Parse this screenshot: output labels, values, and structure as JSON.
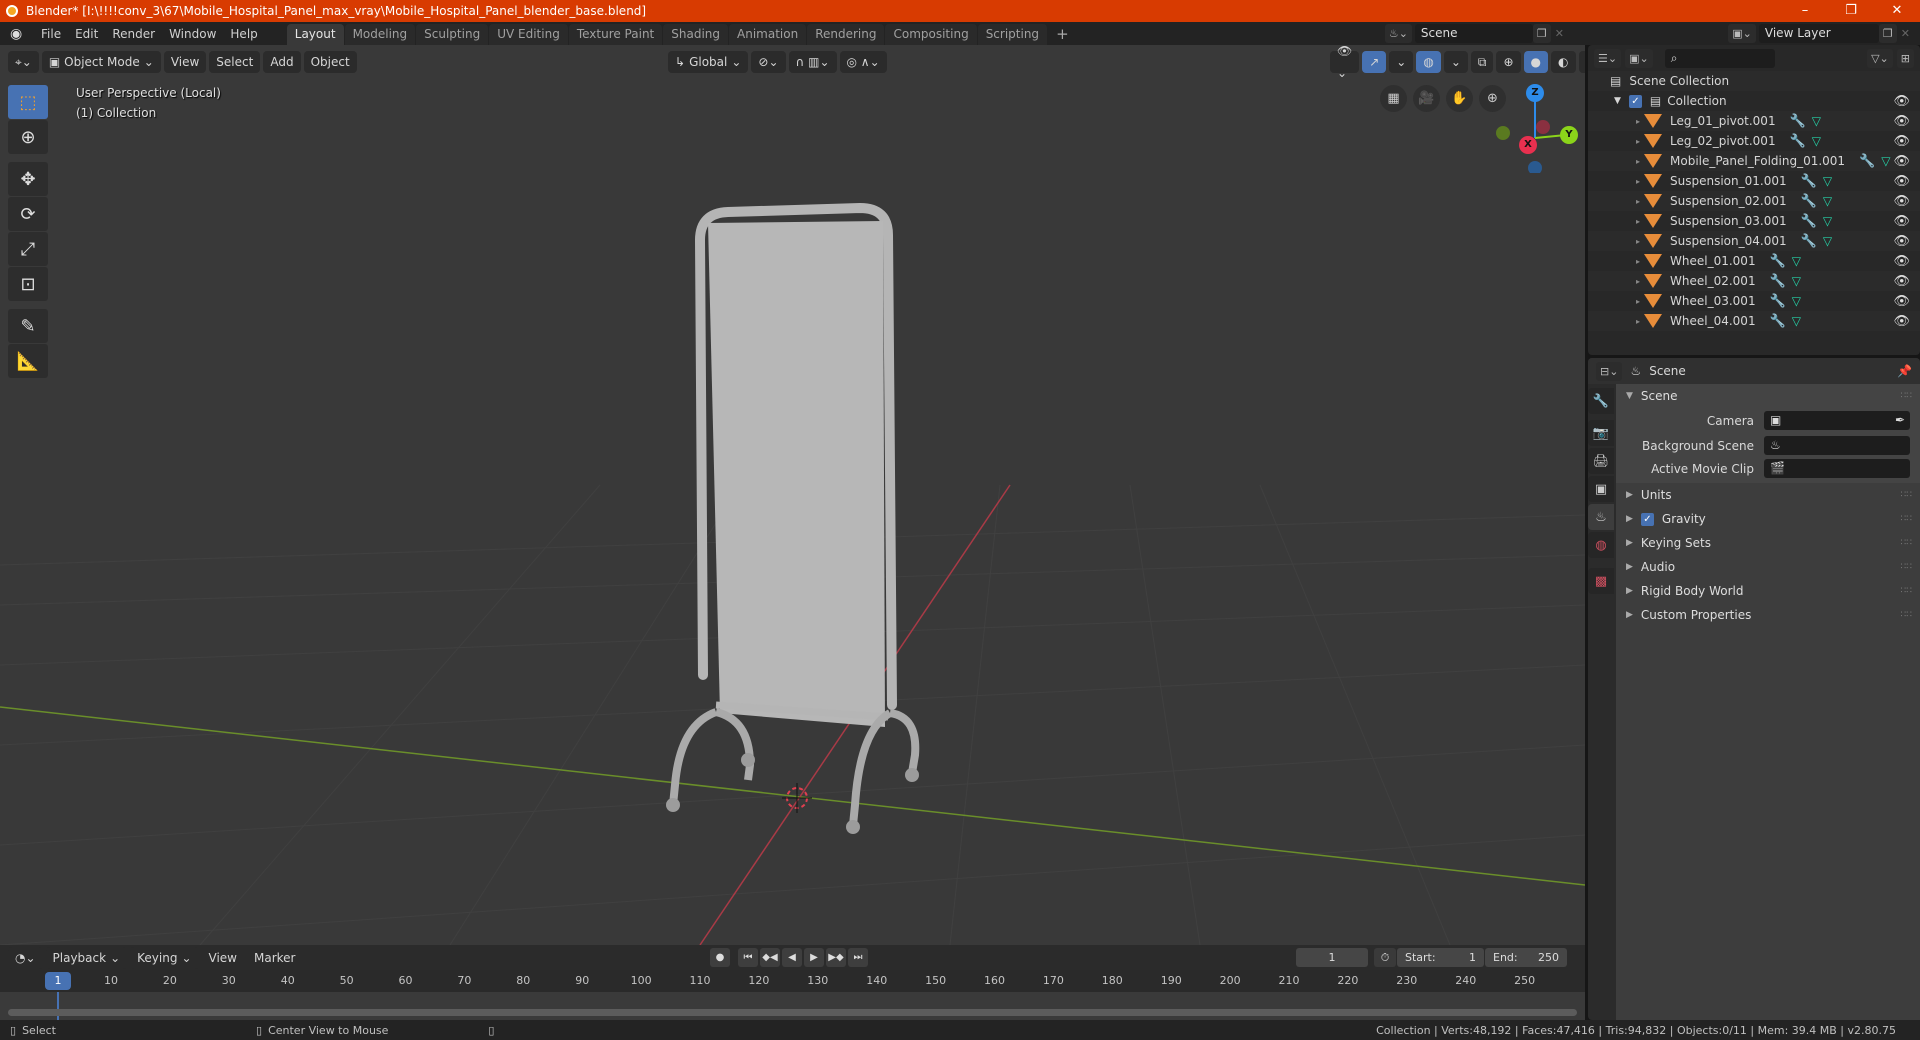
{
  "window": {
    "title": "Blender* [I:\\!!!!conv_3\\67\\Mobile_Hospital_Panel_max_vray\\Mobile_Hospital_Panel_blender_base.blend]",
    "controls": {
      "minimize": "–",
      "maximize": "❐",
      "close": "✕"
    }
  },
  "menubar": {
    "items": [
      "File",
      "Edit",
      "Render",
      "Window",
      "Help"
    ],
    "workspaces": [
      "Layout",
      "Modeling",
      "Sculpting",
      "UV Editing",
      "Texture Paint",
      "Shading",
      "Animation",
      "Rendering",
      "Compositing",
      "Scripting"
    ],
    "active_workspace": "Layout",
    "add_workspace": "+",
    "scene": "Scene",
    "view_layer": "View Layer"
  },
  "viewport": {
    "mode": "Object Mode",
    "menus": [
      "View",
      "Select",
      "Add",
      "Object"
    ],
    "transform_orientation": "Global",
    "info_line1": "User Perspective (Local)",
    "info_line2": "(1) Collection",
    "gizmo_axes": {
      "x": "X",
      "y": "Y",
      "z": "Z"
    },
    "colors": {
      "background": "#393939",
      "x_axis": "#e8304f",
      "y_axis": "#8bd41a",
      "z_axis": "#2d8ceb",
      "model": "#b8b8b8"
    }
  },
  "outliner": {
    "root": "Scene Collection",
    "collection": "Collection",
    "objects": [
      "Leg_01_pivot.001",
      "Leg_02_pivot.001",
      "Mobile_Panel_Folding_01.001",
      "Suspension_01.001",
      "Suspension_02.001",
      "Suspension_03.001",
      "Suspension_04.001",
      "Wheel_01.001",
      "Wheel_02.001",
      "Wheel_03.001",
      "Wheel_04.001"
    ]
  },
  "properties": {
    "context": "Scene",
    "panel_title": "Scene",
    "fields": [
      {
        "label": "Camera",
        "value": ""
      },
      {
        "label": "Background Scene",
        "value": ""
      },
      {
        "label": "Active Movie Clip",
        "value": ""
      }
    ],
    "sections": [
      "Units",
      "Gravity",
      "Keying Sets",
      "Audio",
      "Rigid Body World",
      "Custom Properties"
    ],
    "gravity_enabled": true
  },
  "timeline": {
    "menus": [
      "Playback",
      "Keying",
      "View",
      "Marker"
    ],
    "current_frame": "1",
    "start_label": "Start:",
    "start": "1",
    "end_label": "End:",
    "end": "250",
    "ticks": [
      "10",
      "20",
      "30",
      "40",
      "50",
      "60",
      "70",
      "80",
      "90",
      "100",
      "110",
      "120",
      "130",
      "140",
      "150",
      "160",
      "170",
      "180",
      "190",
      "200",
      "210",
      "220",
      "230",
      "240",
      "250"
    ]
  },
  "statusbar": {
    "left_action": "Select",
    "middle_action": "Center View to Mouse",
    "stats": "Collection | Verts:48,192 | Faces:47,416 | Tris:94,832 | Objects:0/11 | Mem: 39.4 MB | v2.80.75"
  }
}
